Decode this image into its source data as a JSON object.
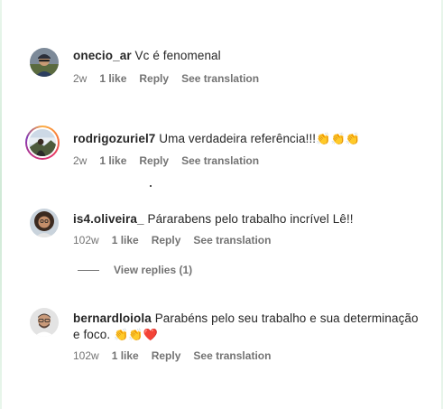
{
  "comments": [
    {
      "username": "onecio_ar",
      "text": "Vc é fenomenal",
      "time": "2w",
      "likes": "1 like",
      "reply": "Reply",
      "translate": "See translation",
      "avatar": "avatar-man-cap-icon",
      "has_story": false
    },
    {
      "username": "rodrigozuriel7",
      "text": "Uma verdadeira referência!!!",
      "emojis": "👏👏👏",
      "time": "2w",
      "likes": "1 like",
      "reply": "Reply",
      "translate": "See translation",
      "avatar": "avatar-landscape-icon",
      "has_story": true
    },
    {
      "username": "is4.oliveira_",
      "text": "Párarabens pelo trabalho incrível Lê!!",
      "time": "102w",
      "likes": "1 like",
      "reply": "Reply",
      "translate": "See translation",
      "avatar": "avatar-woman-curly-icon",
      "has_story": false,
      "view_replies": "View replies (1)"
    },
    {
      "username": "bernardloiola",
      "text_line1": "Parabéns pelo seu trabalho e sua determinação",
      "text_line2": "e foco.",
      "emojis": "👏👏❤️",
      "time": "102w",
      "likes": "1 like",
      "reply": "Reply",
      "translate": "See translation",
      "avatar": "avatar-man-glasses-icon",
      "has_story": false
    }
  ],
  "colors": {
    "text": "#262626",
    "meta": "#737373",
    "background": "#ffffff"
  }
}
